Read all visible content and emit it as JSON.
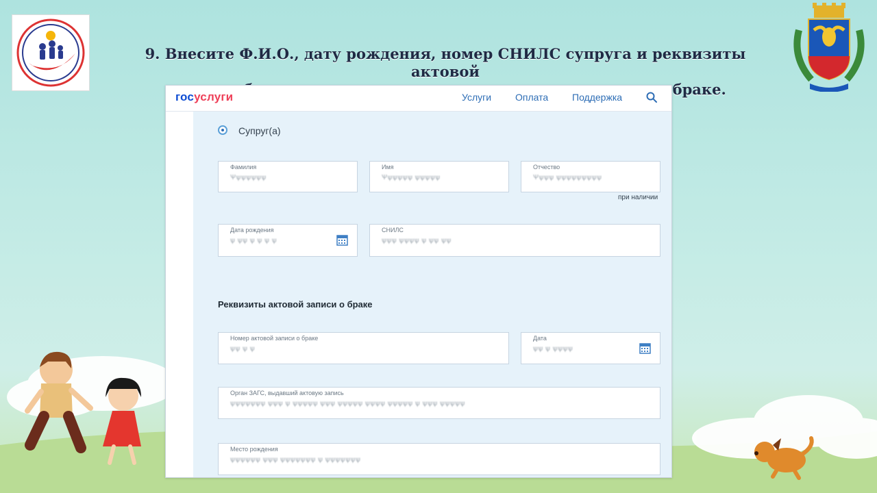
{
  "slide": {
    "title_line1": "9. Внесите Ф.И.О., дату рождения, номер СНИЛС супруга и реквизиты актовой",
    "title_line2": "записи о браке — их можно посмотреть на свидетельстве о браке."
  },
  "header": {
    "brand_gos": "гос",
    "brand_uslugi": "услуги",
    "nav": [
      "Услуги",
      "Оплата",
      "Поддержка"
    ]
  },
  "form": {
    "radio_label": "Супруг(а)",
    "fields": {
      "last_name": {
        "label": "Фамилия",
        "value": "Ѱѱѱѱѱѱѱ"
      },
      "first_name": {
        "label": "Имя",
        "value": "Ѱѱѱѱѱѱ ѱѱѱѱѱ"
      },
      "patronymic": {
        "label": "Отчество",
        "value": "Ѱѱѱѱ ѱѱѱѱѱѱѱѱѱ"
      },
      "birth_date": {
        "label": "Дата рождения",
        "value": "ѱ ѱѱ ѱ ѱ ѱ ѱ"
      },
      "snils": {
        "label": "СНИЛС",
        "value": "ѱѱѱ ѱѱѱѱ ѱ ѱѱ ѱѱ"
      },
      "record_number": {
        "label": "Номер актовой записи о браке",
        "value": "ѱѱ ѱ ѱ"
      },
      "record_date": {
        "label": "Дата",
        "value": "ѱѱ ѱ ѱѱѱѱ"
      },
      "registry_office": {
        "label": "Орган ЗАГС, выдавший актовую запись",
        "value": "ѱѱѱѱѱѱѱ ѱѱѱ ѱ ѱѱѱѱѱ ѱѱѱ ѱѱѱѱѱ ѱѱѱѱ ѱѱѱѱѱ ѱ ѱѱѱ ѱѱѱѱѱ"
      },
      "birth_place": {
        "label": "Место рождения",
        "value": "ѱѱѱѱѱѱ ѱѱѱ ѱѱѱѱѱѱѱ ѱ ѱѱѱѱѱѱѱ"
      }
    },
    "hint": "при наличии",
    "section_title": "Реквизиты актовой записи о браке"
  },
  "colors": {
    "brand_blue": "#0d4cd3",
    "brand_red": "#ee3f58",
    "link_blue": "#2d6db5",
    "panel_bg": "#e6f2fa"
  },
  "icons": {
    "search": "search-icon",
    "calendar": "calendar-icon"
  }
}
